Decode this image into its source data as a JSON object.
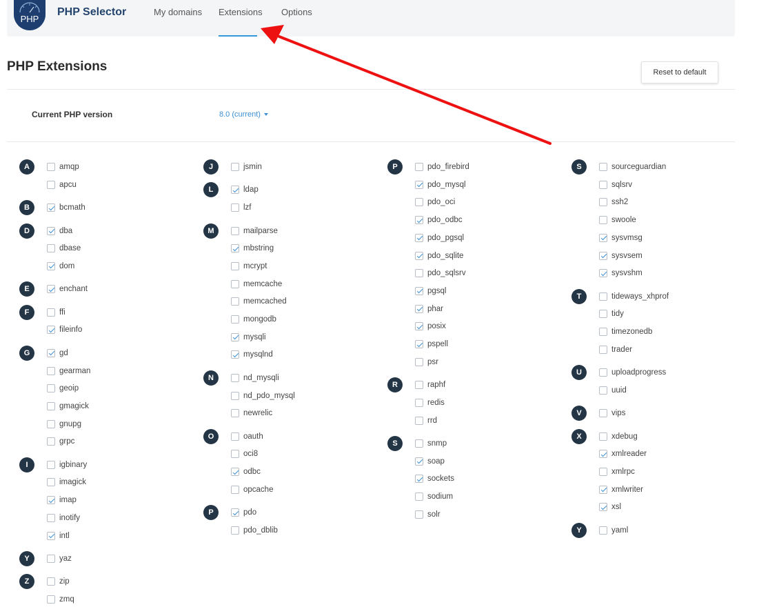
{
  "app": {
    "title": "PHP Selector",
    "logo_text": "PHP"
  },
  "nav": {
    "tabs": [
      {
        "label": "My domains",
        "active": false
      },
      {
        "label": "Extensions",
        "active": true
      },
      {
        "label": "Options",
        "active": false
      }
    ]
  },
  "page": {
    "title": "PHP Extensions",
    "reset_label": "Reset to default"
  },
  "version": {
    "label": "Current PHP version",
    "value": "8.0 (current)"
  },
  "colors": {
    "accent": "#3a8fd6",
    "letter_bg": "#243546",
    "annotation_arrow": "#ee1111"
  },
  "columns": [
    {
      "groups": [
        {
          "letter": "A",
          "items": [
            {
              "name": "amqp",
              "checked": false
            },
            {
              "name": "apcu",
              "checked": false
            }
          ]
        },
        {
          "letter": "B",
          "items": [
            {
              "name": "bcmath",
              "checked": true
            }
          ]
        },
        {
          "letter": "D",
          "items": [
            {
              "name": "dba",
              "checked": true
            },
            {
              "name": "dbase",
              "checked": false
            },
            {
              "name": "dom",
              "checked": true
            }
          ]
        },
        {
          "letter": "E",
          "items": [
            {
              "name": "enchant",
              "checked": true
            }
          ]
        },
        {
          "letter": "F",
          "items": [
            {
              "name": "ffi",
              "checked": false
            },
            {
              "name": "fileinfo",
              "checked": true
            }
          ]
        },
        {
          "letter": "G",
          "items": [
            {
              "name": "gd",
              "checked": true
            },
            {
              "name": "gearman",
              "checked": false
            },
            {
              "name": "geoip",
              "checked": false
            },
            {
              "name": "gmagick",
              "checked": false
            },
            {
              "name": "gnupg",
              "checked": false
            },
            {
              "name": "grpc",
              "checked": false
            }
          ]
        },
        {
          "letter": "I",
          "items": [
            {
              "name": "igbinary",
              "checked": false
            },
            {
              "name": "imagick",
              "checked": false
            },
            {
              "name": "imap",
              "checked": true
            },
            {
              "name": "inotify",
              "checked": false
            },
            {
              "name": "intl",
              "checked": true
            }
          ]
        },
        {
          "letter": "Y",
          "items": [
            {
              "name": "yaz",
              "checked": false
            }
          ]
        },
        {
          "letter": "Z",
          "items": [
            {
              "name": "zip",
              "checked": false
            },
            {
              "name": "zmq",
              "checked": false
            }
          ]
        }
      ]
    },
    {
      "groups": [
        {
          "letter": "J",
          "items": [
            {
              "name": "jsmin",
              "checked": false
            }
          ]
        },
        {
          "letter": "L",
          "items": [
            {
              "name": "ldap",
              "checked": true
            },
            {
              "name": "lzf",
              "checked": false
            }
          ]
        },
        {
          "letter": "M",
          "items": [
            {
              "name": "mailparse",
              "checked": false
            },
            {
              "name": "mbstring",
              "checked": true
            },
            {
              "name": "mcrypt",
              "checked": false
            },
            {
              "name": "memcache",
              "checked": false
            },
            {
              "name": "memcached",
              "checked": false
            },
            {
              "name": "mongodb",
              "checked": false
            },
            {
              "name": "mysqli",
              "checked": true
            },
            {
              "name": "mysqlnd",
              "checked": true
            }
          ]
        },
        {
          "letter": "N",
          "items": [
            {
              "name": "nd_mysqli",
              "checked": false
            },
            {
              "name": "nd_pdo_mysql",
              "checked": false
            },
            {
              "name": "newrelic",
              "checked": false
            }
          ]
        },
        {
          "letter": "O",
          "items": [
            {
              "name": "oauth",
              "checked": false
            },
            {
              "name": "oci8",
              "checked": false
            },
            {
              "name": "odbc",
              "checked": true
            },
            {
              "name": "opcache",
              "checked": false
            }
          ]
        },
        {
          "letter": "P",
          "items": [
            {
              "name": "pdo",
              "checked": true
            },
            {
              "name": "pdo_dblib",
              "checked": false
            }
          ]
        }
      ]
    },
    {
      "groups": [
        {
          "letter": "P",
          "items": [
            {
              "name": "pdo_firebird",
              "checked": false
            },
            {
              "name": "pdo_mysql",
              "checked": true
            },
            {
              "name": "pdo_oci",
              "checked": false
            },
            {
              "name": "pdo_odbc",
              "checked": true
            },
            {
              "name": "pdo_pgsql",
              "checked": true
            },
            {
              "name": "pdo_sqlite",
              "checked": true
            },
            {
              "name": "pdo_sqlsrv",
              "checked": false
            },
            {
              "name": "pgsql",
              "checked": true
            },
            {
              "name": "phar",
              "checked": true
            },
            {
              "name": "posix",
              "checked": true
            },
            {
              "name": "pspell",
              "checked": true
            },
            {
              "name": "psr",
              "checked": false
            }
          ]
        },
        {
          "letter": "R",
          "items": [
            {
              "name": "raphf",
              "checked": false
            },
            {
              "name": "redis",
              "checked": false
            },
            {
              "name": "rrd",
              "checked": false
            }
          ]
        },
        {
          "letter": "S",
          "items": [
            {
              "name": "snmp",
              "checked": false
            },
            {
              "name": "soap",
              "checked": true
            },
            {
              "name": "sockets",
              "checked": true
            },
            {
              "name": "sodium",
              "checked": false
            },
            {
              "name": "solr",
              "checked": false
            }
          ]
        }
      ]
    },
    {
      "groups": [
        {
          "letter": "S",
          "items": [
            {
              "name": "sourceguardian",
              "checked": false
            },
            {
              "name": "sqlsrv",
              "checked": false
            },
            {
              "name": "ssh2",
              "checked": false
            },
            {
              "name": "swoole",
              "checked": false
            },
            {
              "name": "sysvmsg",
              "checked": true
            },
            {
              "name": "sysvsem",
              "checked": true
            },
            {
              "name": "sysvshm",
              "checked": true
            }
          ]
        },
        {
          "letter": "T",
          "items": [
            {
              "name": "tideways_xhprof",
              "checked": false
            },
            {
              "name": "tidy",
              "checked": false
            },
            {
              "name": "timezonedb",
              "checked": false
            },
            {
              "name": "trader",
              "checked": false
            }
          ]
        },
        {
          "letter": "U",
          "items": [
            {
              "name": "uploadprogress",
              "checked": false
            },
            {
              "name": "uuid",
              "checked": false
            }
          ]
        },
        {
          "letter": "V",
          "items": [
            {
              "name": "vips",
              "checked": false
            }
          ]
        },
        {
          "letter": "X",
          "items": [
            {
              "name": "xdebug",
              "checked": false
            },
            {
              "name": "xmlreader",
              "checked": true
            },
            {
              "name": "xmlrpc",
              "checked": false
            },
            {
              "name": "xmlwriter",
              "checked": true
            },
            {
              "name": "xsl",
              "checked": true
            }
          ]
        },
        {
          "letter": "Y",
          "items": [
            {
              "name": "yaml",
              "checked": false
            }
          ]
        }
      ]
    }
  ]
}
